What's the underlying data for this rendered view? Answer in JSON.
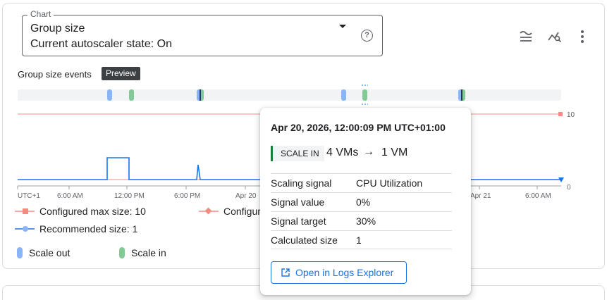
{
  "chart_selector": {
    "legend": "Chart",
    "title": "Group size",
    "subtitle": "Current autoscaler state: On",
    "help_icon": "help-icon"
  },
  "toolbar": {
    "icons": [
      "filter-lines-icon",
      "chart-search-icon",
      "more-vert-icon"
    ]
  },
  "events": {
    "label": "Group size events",
    "badge": "Preview"
  },
  "chart_data": {
    "type": "line",
    "x_tick_labels": [
      "UTC+1",
      "6:00 AM",
      "12:00 PM",
      "6:00 PM",
      "Apr 20",
      "Apr 21",
      "6:00 AM"
    ],
    "y_ticks": [
      0,
      10
    ],
    "ylim": [
      0,
      10
    ],
    "series": [
      {
        "name": "Configured max size: 10",
        "color": "#f28b82",
        "values": [
          10,
          10
        ]
      },
      {
        "name": "Recommended size: 1",
        "color": "#1a73e8",
        "values": [
          1,
          1,
          4,
          4,
          1,
          1,
          3,
          1,
          1
        ]
      }
    ],
    "events": [
      {
        "type": "Scale out"
      },
      {
        "type": "Scale in"
      },
      {
        "type": "Scale out"
      },
      {
        "type": "Scale in"
      },
      {
        "type": "Scale out"
      },
      {
        "type": "Scale in"
      },
      {
        "type": "Scale out"
      },
      {
        "type": "Scale in"
      }
    ]
  },
  "legend": {
    "max_size": "Configured max size: 10",
    "min_size_partial": "Configur",
    "recommended": "Recommended size: 1",
    "scale_out": "Scale out",
    "scale_in": "Scale in"
  },
  "tooltip": {
    "date": "Apr 20, 2026, 12:00:09 PM UTC+01:00",
    "badge": "SCALE IN",
    "from": "4 VMs",
    "arrow": "→",
    "to": "1 VM",
    "rows": [
      {
        "key": "Scaling signal",
        "value": "CPU Utilization"
      },
      {
        "key": "Signal value",
        "value": "0%"
      },
      {
        "key": "Signal target",
        "value": "30%"
      },
      {
        "key": "Calculated size",
        "value": "1"
      }
    ],
    "button": "Open in Logs Explorer"
  },
  "colors": {
    "accent": "#1a73e8",
    "max_line": "#f28b82",
    "scale_out": "#8ab4f8",
    "scale_in": "#81c995",
    "scale_in_badge": "#188038"
  }
}
